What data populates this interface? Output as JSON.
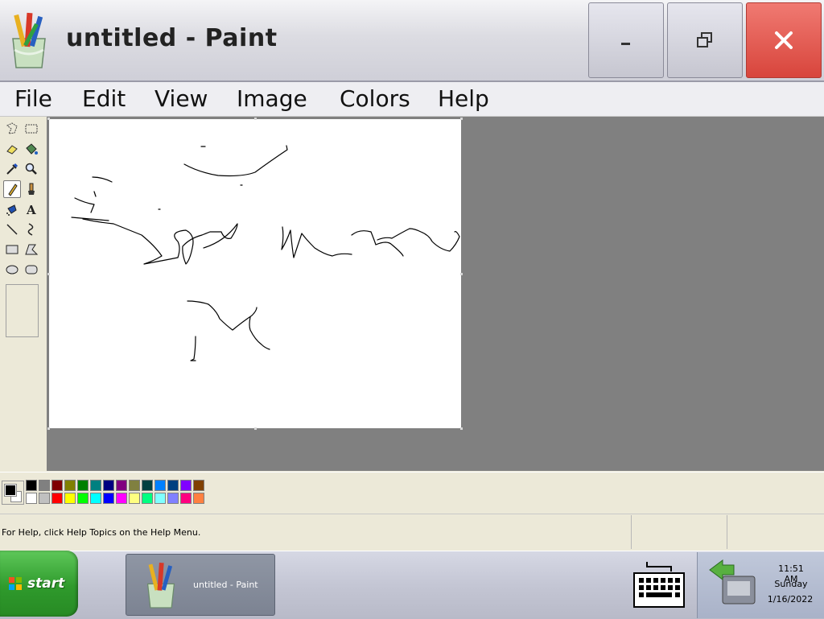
{
  "window": {
    "title": "untitled - Paint"
  },
  "menu": [
    "File",
    "Edit",
    "View",
    "Image",
    "Colors",
    "Help"
  ],
  "tools": [
    {
      "name": "free-form-select-icon",
      "selected": false
    },
    {
      "name": "rect-select-icon",
      "selected": false
    },
    {
      "name": "eraser-icon",
      "selected": false
    },
    {
      "name": "fill-bucket-icon",
      "selected": false
    },
    {
      "name": "color-picker-icon",
      "selected": false
    },
    {
      "name": "magnifier-icon",
      "selected": false
    },
    {
      "name": "pencil-icon",
      "selected": true
    },
    {
      "name": "brush-icon",
      "selected": false
    },
    {
      "name": "airbrush-icon",
      "selected": false
    },
    {
      "name": "text-icon",
      "selected": false
    },
    {
      "name": "line-icon",
      "selected": false
    },
    {
      "name": "curve-icon",
      "selected": false
    },
    {
      "name": "rectangle-icon",
      "selected": false
    },
    {
      "name": "polygon-icon",
      "selected": false
    },
    {
      "name": "ellipse-icon",
      "selected": false
    },
    {
      "name": "rounded-rect-icon",
      "selected": false
    }
  ],
  "palette": {
    "foreground": "#000000",
    "background": "#ffffff",
    "top_row": [
      "#000000",
      "#808080",
      "#800000",
      "#808000",
      "#008000",
      "#008080",
      "#000080",
      "#800080",
      "#808040",
      "#004040",
      "#0080ff",
      "#004080",
      "#8000ff",
      "#804000"
    ],
    "bottom_row": [
      "#ffffff",
      "#c0c0c0",
      "#ff0000",
      "#ffff00",
      "#00ff00",
      "#00ffff",
      "#0000ff",
      "#ff00ff",
      "#ffff80",
      "#00ff80",
      "#80ffff",
      "#8080ff",
      "#ff0080",
      "#ff8040"
    ]
  },
  "status": {
    "text": "For Help, click Help Topics on the Help Menu."
  },
  "taskbar": {
    "start_label": "start",
    "task_label": "untitled - Paint",
    "clock_time": "11:51 AM",
    "clock_day": "Sunday",
    "clock_date": "1/16/2022"
  }
}
